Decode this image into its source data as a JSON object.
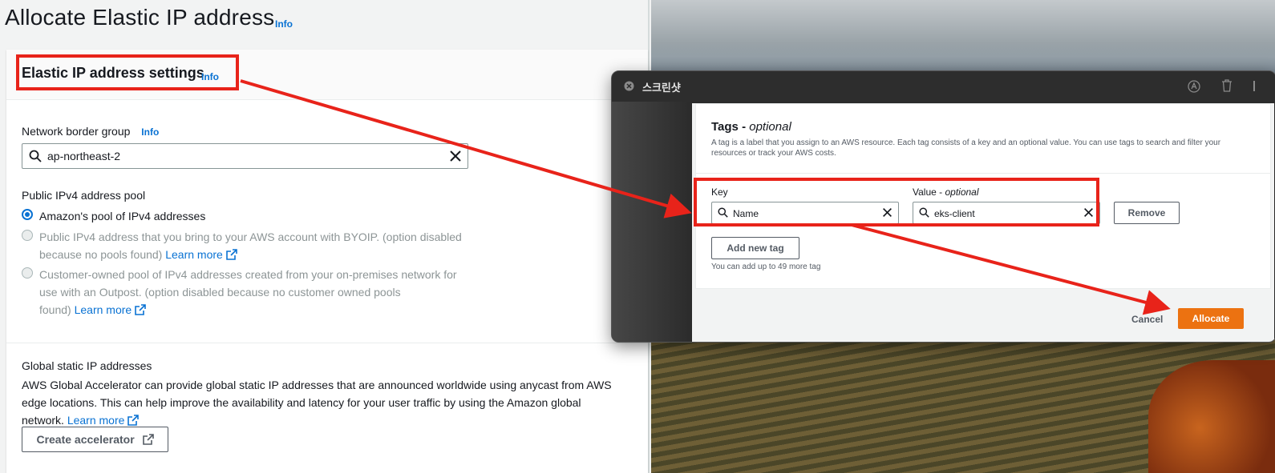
{
  "left": {
    "page_title": "Allocate Elastic IP address",
    "title_info": "Info",
    "panel_title": "Elastic IP address settings",
    "panel_info": "Info",
    "nbg_label": "Network border group",
    "nbg_info": "Info",
    "nbg_value": "ap-northeast-2",
    "pool_label": "Public IPv4 address pool",
    "pool_options": [
      {
        "line1": "Amazon's pool of IPv4 addresses",
        "selected": true
      },
      {
        "line1": "Public IPv4 address that you bring to your AWS account with BYOIP. (option disabled",
        "line2": "because no pools found)",
        "link": "Learn more"
      },
      {
        "line1": "Customer-owned pool of IPv4 addresses created from your on-premises network for",
        "line2": "use with an Outpost. (option disabled because no customer owned pools",
        "line3": "found)",
        "link": "Learn more"
      }
    ],
    "global_label": "Global static IP addresses",
    "global_desc_1": "AWS Global Accelerator can provide global static IP addresses that are announced worldwide using anycast from AWS",
    "global_desc_2": "edge locations. This can help improve the availability and latency for your user traffic by using the Amazon global",
    "global_desc_3": "network.",
    "global_link": "Learn more",
    "create_accel_button": "Create accelerator"
  },
  "window": {
    "title": "스크린샷",
    "tags_title": "Tags - ",
    "tags_title_optional": "optional",
    "tags_desc": "A tag is a label that you assign to an AWS resource. Each tag consists of a key and an optional value. You can use tags to search and filter your resources or track your AWS costs.",
    "key_label": "Key",
    "value_label": "Value - ",
    "value_label_optional": "optional",
    "key_value": "Name",
    "value_value": "eks-client",
    "remove_button": "Remove",
    "add_tag_button": "Add new tag",
    "hint": "You can add up to 49 more tag",
    "cancel": "Cancel",
    "allocate": "Allocate"
  },
  "colors": {
    "annotation_red": "#e8231a",
    "aws_link_blue": "#0972d3",
    "allocate_orange": "#ec7211"
  }
}
